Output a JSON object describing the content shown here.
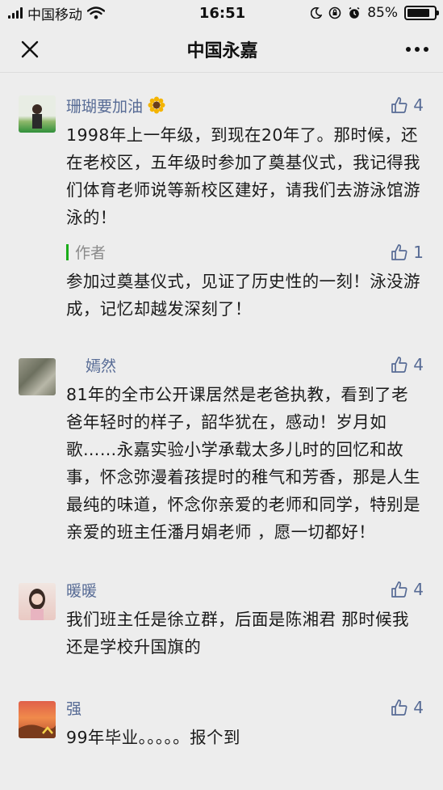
{
  "status_bar": {
    "carrier": "中国移动",
    "time": "16:51",
    "battery_percent": "85%",
    "battery_level": 0.85,
    "icons": [
      "signal-icon",
      "wifi-icon",
      "moon-icon",
      "orientation-lock-icon",
      "alarm-icon",
      "battery-icon"
    ]
  },
  "nav": {
    "title": "中国永嘉",
    "close_icon": "close-icon",
    "more_icon": "more-icon"
  },
  "colors": {
    "background": "#ededed",
    "name": "#576b95",
    "reply_accent": "#1aad19"
  },
  "comments": [
    {
      "author": "珊瑚要加油",
      "likes": "4",
      "text": "1998年上一年级，到现在20年了。那时候，还在老校区，五年级时参加了奠基仪式，我记得我们体育老师说等新校区建好，请我们去游泳馆游泳的！",
      "reply": {
        "label": "作者",
        "likes": "1",
        "text": "参加过奠基仪式，见证了历史性的一刻！泳没游成，记忆却越发深刻了！"
      }
    },
    {
      "author": "嫣然",
      "likes": "4",
      "text": "81年的全市公开课居然是老爸执教，看到了老爸年轻时的样子，韶华犹在，感动！岁月如歌……永嘉实验小学承载太多儿时的回忆和故事，怀念弥漫着孩提时的稚气和芳香，那是人生最纯的味道，怀念你亲爱的老师和同学，特别是亲爱的班主任潘月娟老师 ，愿一切都好！"
    },
    {
      "author": "暖暖",
      "likes": "4",
      "text": "我们班主任是徐立群，后面是陈湘君 那时候我还是学校升国旗的"
    },
    {
      "author": "强",
      "likes": "4",
      "text": "99年毕业。。。。。报个到"
    }
  ]
}
